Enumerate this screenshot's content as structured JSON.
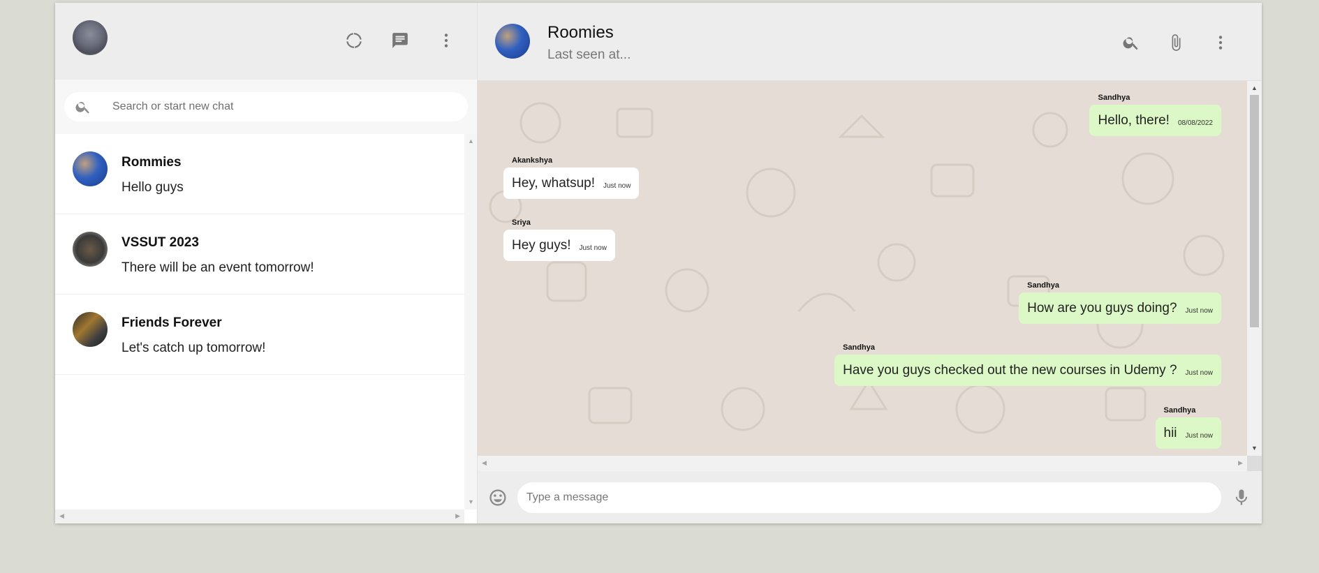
{
  "sidebar": {
    "search": {
      "placeholder": "Search or start new chat"
    },
    "chats": [
      {
        "name": "Rommies",
        "last_message": "Hello guys"
      },
      {
        "name": "VSSUT 2023",
        "last_message": "There will be an event tomorrow!"
      },
      {
        "name": "Friends Forever",
        "last_message": "Let's catch up tomorrow!"
      }
    ]
  },
  "conversation": {
    "title": "Roomies",
    "subtitle": "Last seen at...",
    "messages": [
      {
        "sender": "Sandhya",
        "text": "Hello, there!",
        "time": "08/08/2022",
        "mine": true
      },
      {
        "sender": "Akankshya",
        "text": "Hey, whatsup!",
        "time": "Just now",
        "mine": false
      },
      {
        "sender": "Sriya",
        "text": "Hey guys!",
        "time": "Just now",
        "mine": false
      },
      {
        "sender": "Sandhya",
        "text": "How are you guys doing?",
        "time": "Just now",
        "mine": true
      },
      {
        "sender": "Sandhya",
        "text": "Have you guys checked out the new courses in Udemy ?",
        "time": "Just now",
        "mine": true
      },
      {
        "sender": "Sandhya",
        "text": "hii",
        "time": "Just now",
        "mine": true
      }
    ],
    "composer": {
      "placeholder": "Type a message"
    }
  },
  "colors": {
    "header_bg": "#ededed",
    "chat_bg": "#e5ddd5",
    "outgoing_bubble": "#dcf8c6",
    "incoming_bubble": "#ffffff"
  },
  "icons": {
    "sidebar_header": [
      "status-icon",
      "new-chat-icon",
      "menu-icon"
    ],
    "conversation_header": [
      "search-icon",
      "attach-icon",
      "menu-icon"
    ],
    "composer": [
      "emoji-icon",
      "mic-icon"
    ]
  }
}
